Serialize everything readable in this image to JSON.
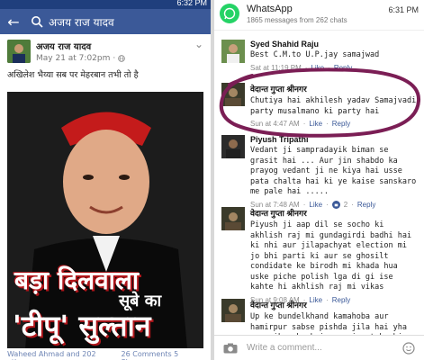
{
  "left": {
    "status_time": "6:32 PM",
    "search_query": "अजय राज यादव",
    "post": {
      "author": "अजय राज यादव",
      "date": "May 21 at 7:02pm",
      "separator": "·",
      "text": "अखिलेश भैय्या सब पर मेहरबान तभी तो है",
      "poster_line1": "बड़ा दिलवाला",
      "poster_line2": "सूबे का",
      "poster_line3": "'टीपू' सुल्तान",
      "reactions": "Waheed Ahmad and 202 others",
      "shares": "26 Comments  5 Shares"
    }
  },
  "notification": {
    "app": "WhatsApp",
    "subtitle": "1865 messages from 262 chats",
    "time": "6:31 PM"
  },
  "comments": [
    {
      "name": "Syed Shahid Raju",
      "text": "Best C.M.to U.P.jay samajwad",
      "time": "Sat at 11:19 PM",
      "like": "Like",
      "reply": "Reply",
      "likes": ""
    },
    {
      "name": "वेदान्त गुप्ता श्रीनगर",
      "text": "Chutiya hai akhilesh yadav Samajvadi party musalmano ki party hai",
      "time": "Sun at 4:47 AM",
      "like": "Like",
      "reply": "Reply",
      "likes": ""
    },
    {
      "name": "Piyush Tripathi",
      "text": "Vedant ji sampradayik biman se grasit hai ... Aur jin shabdo ka prayog vedant ji ne kiya hai usse pata chalta hai ki ye kaise sanskaro me pale hai .....",
      "time": "Sun at 7:48 AM",
      "like": "Like",
      "reply": "Reply",
      "likes": "2"
    },
    {
      "name": "वेदान्त गुप्ता श्रीनगर",
      "text": "Piyush ji aap dil se socho ki akhlish raj mi gundagirdi badhi hai ki nhi aur jilapachyat election mi jo bhi parti ki aur se ghosilt condidate ke birodh mi khada hua uske piche polish lga di gi ise kahte hi akhlish raj mi vikas",
      "time": "Sun at 9:08 AM",
      "like": "Like",
      "reply": "Reply",
      "likes": ""
    },
    {
      "name": "वेदान्त गुप्ता श्रीनगर",
      "text": "Up ke bundelkhand kamahoba aur hamirpur sabse pishda jila hai yha par vikas ka koi namonisa tak nhi hai",
      "time": "",
      "like": "",
      "reply": "",
      "likes": ""
    }
  ],
  "composer": {
    "placeholder": "Write a comment..."
  },
  "colors": {
    "facebook_blue": "#3b5998",
    "whatsapp_green": "#25d366",
    "annotation_circle": "#7b1e55"
  },
  "icons": [
    "back-arrow-icon",
    "search-icon",
    "globe-icon",
    "whatsapp-icon",
    "like-thumb-icon",
    "camera-icon",
    "emoji-icon"
  ]
}
